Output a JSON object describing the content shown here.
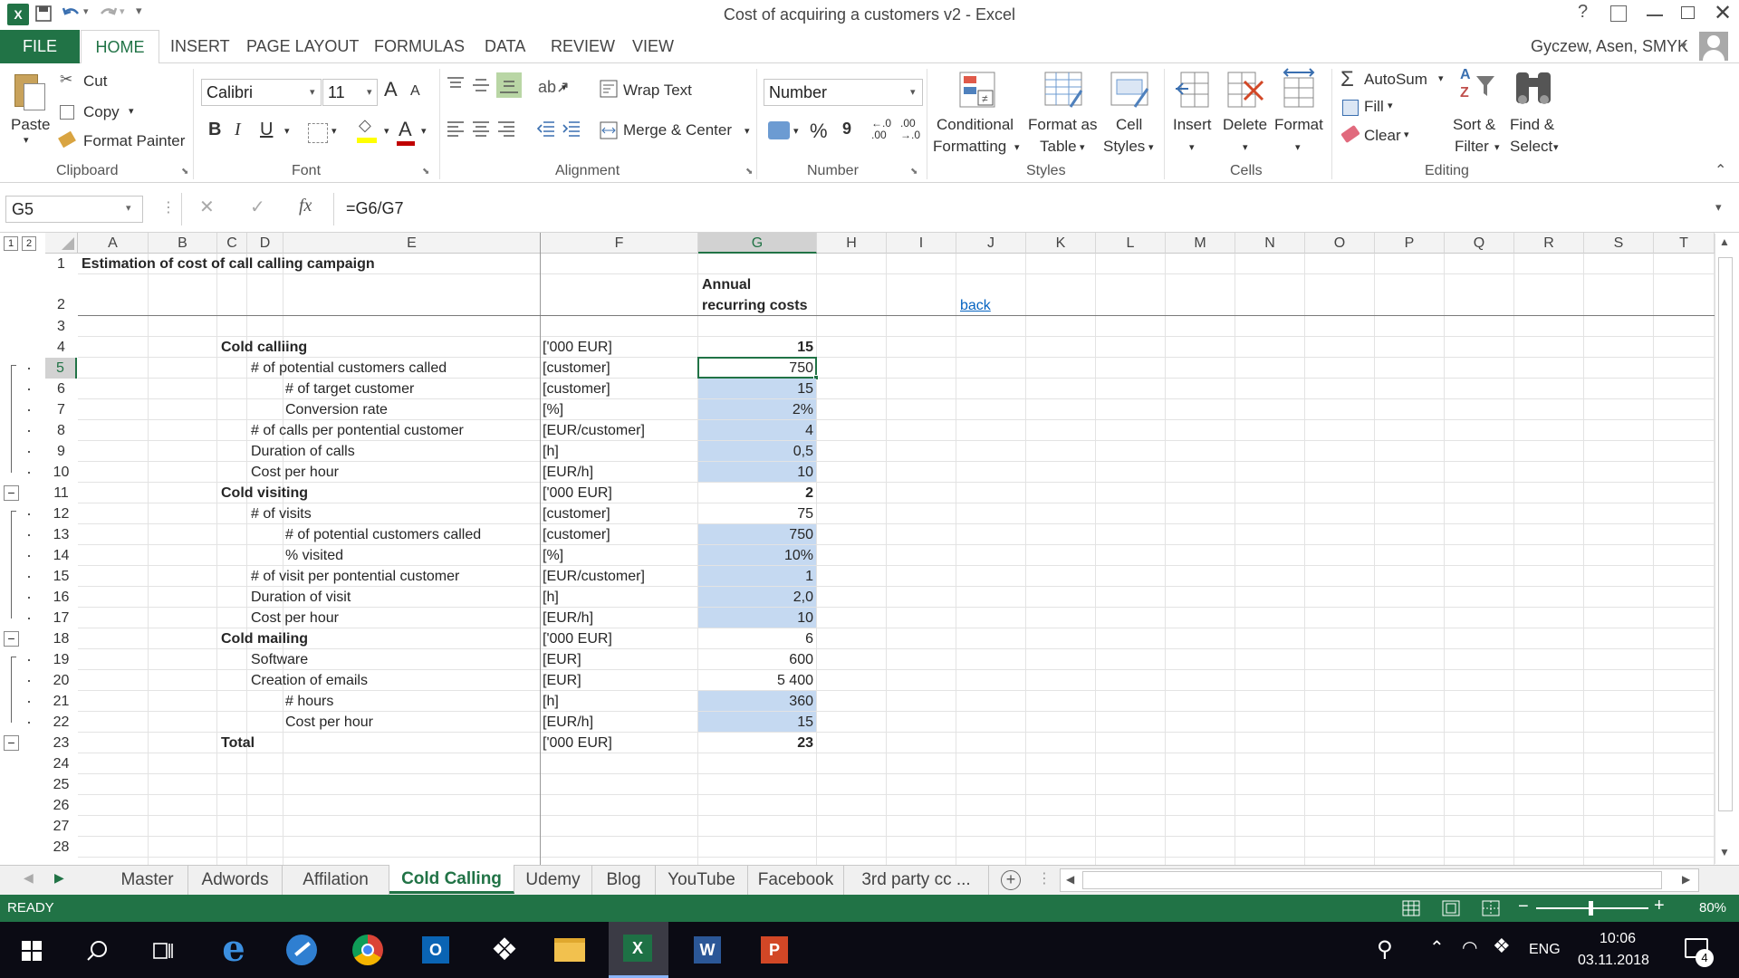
{
  "window": {
    "title": "Cost of acquiring a customers v2 - Excel",
    "user": "Gyczew, Asen, SMYK"
  },
  "ribbon_tabs": [
    "FILE",
    "HOME",
    "INSERT",
    "PAGE LAYOUT",
    "FORMULAS",
    "DATA",
    "REVIEW",
    "VIEW"
  ],
  "clipboard": {
    "paste": "Paste",
    "cut": "Cut",
    "copy": "Copy",
    "format_painter": "Format Painter",
    "label": "Clipboard"
  },
  "font": {
    "name": "Calibri",
    "size": "11",
    "bold": "B",
    "italic": "I",
    "underline": "U",
    "label": "Font"
  },
  "alignment": {
    "wrap": "Wrap Text",
    "merge": "Merge & Center",
    "label": "Alignment"
  },
  "number": {
    "format": "Number",
    "percent": "%",
    "comma": "9",
    "inc": "←.0\n.00",
    "dec": ".00\n→.0",
    "label": "Number"
  },
  "styles": {
    "conditional": "Conditional",
    "formatting": "Formatting",
    "format_as": "Format as",
    "table": "Table",
    "cell": "Cell",
    "styles": "Styles",
    "label": "Styles"
  },
  "cells": {
    "insert": "Insert",
    "delete": "Delete",
    "format": "Format",
    "label": "Cells"
  },
  "editing": {
    "autosum": "AutoSum",
    "fill": "Fill",
    "clear": "Clear",
    "sort": "Sort &",
    "filter": "Filter",
    "find": "Find &",
    "select": "Select",
    "label": "Editing"
  },
  "formula_bar": {
    "name_box": "G5",
    "fx": "fx",
    "formula": "=G6/G7"
  },
  "outline_levels": [
    "1",
    "2"
  ],
  "columns": [
    "A",
    "B",
    "C",
    "D",
    "E",
    "F",
    "G",
    "H",
    "I",
    "J",
    "K",
    "L",
    "M",
    "N",
    "O",
    "P",
    "Q",
    "R",
    "S",
    "T"
  ],
  "rows": [
    "1",
    "2",
    "3",
    "4",
    "5",
    "6",
    "7",
    "8",
    "9",
    "10",
    "11",
    "12",
    "13",
    "14",
    "15",
    "16",
    "17",
    "18",
    "19",
    "20",
    "21",
    "22",
    "23",
    "24",
    "25",
    "26",
    "27",
    "28"
  ],
  "sheet": {
    "title": "Estimation of cost of call calling campaign",
    "header_line1": "Annual",
    "header_line2": "recurring costs",
    "back": "back",
    "lines": [
      {
        "row": "4",
        "label": "Cold calliing",
        "indent": 0,
        "bold": true,
        "unit": "['000 EUR]",
        "value": "15",
        "vbold": true,
        "shade": false
      },
      {
        "row": "5",
        "label": "# of potential customers called",
        "indent": 1,
        "unit": "[customer]",
        "value": "750",
        "shade": false,
        "selected": true
      },
      {
        "row": "6",
        "label": "# of target customer",
        "indent": 2,
        "unit": "[customer]",
        "value": "15",
        "shade": true
      },
      {
        "row": "7",
        "label": "Conversion rate",
        "indent": 2,
        "unit": "[%]",
        "value": "2%",
        "shade": true
      },
      {
        "row": "8",
        "label": "# of calls per pontential customer",
        "indent": 1,
        "unit": "[EUR/customer]",
        "value": "4",
        "shade": true
      },
      {
        "row": "9",
        "label": "Duration of calls",
        "indent": 1,
        "unit": "[h]",
        "value": "0,5",
        "shade": true
      },
      {
        "row": "10",
        "label": "Cost per hour",
        "indent": 1,
        "unit": "[EUR/h]",
        "value": "10",
        "shade": true
      },
      {
        "row": "11",
        "label": "Cold visiting",
        "indent": 0,
        "bold": true,
        "unit": "['000 EUR]",
        "value": "2",
        "vbold": true,
        "shade": false
      },
      {
        "row": "12",
        "label": "# of visits",
        "indent": 1,
        "unit": "[customer]",
        "value": "75",
        "shade": false
      },
      {
        "row": "13",
        "label": "# of potential customers called",
        "indent": 2,
        "unit": "[customer]",
        "value": "750",
        "shade": true
      },
      {
        "row": "14",
        "label": "% visited",
        "indent": 2,
        "unit": "[%]",
        "value": "10%",
        "shade": true
      },
      {
        "row": "15",
        "label": "# of visit per pontential customer",
        "indent": 1,
        "unit": "[EUR/customer]",
        "value": "1",
        "shade": true
      },
      {
        "row": "16",
        "label": "Duration of visit",
        "indent": 1,
        "unit": "[h]",
        "value": "2,0",
        "shade": true
      },
      {
        "row": "17",
        "label": "Cost per hour",
        "indent": 1,
        "unit": "[EUR/h]",
        "value": "10",
        "shade": true
      },
      {
        "row": "18",
        "label": "Cold mailing",
        "indent": 0,
        "bold": true,
        "unit": "['000 EUR]",
        "value": "6",
        "shade": false
      },
      {
        "row": "19",
        "label": "Software",
        "indent": 1,
        "unit": "[EUR]",
        "value": "600",
        "shade": false
      },
      {
        "row": "20",
        "label": "Creation of emails",
        "indent": 1,
        "unit": "[EUR]",
        "value": "5 400",
        "shade": false
      },
      {
        "row": "21",
        "label": "# hours",
        "indent": 2,
        "unit": "[h]",
        "value": "360",
        "shade": true
      },
      {
        "row": "22",
        "label": "Cost per hour",
        "indent": 2,
        "unit": "[EUR/h]",
        "value": "15",
        "shade": true
      },
      {
        "row": "23",
        "label": "Total",
        "indent": 0,
        "bold": true,
        "unit": "['000 EUR]",
        "value": "23",
        "vbold": true,
        "shade": false
      }
    ]
  },
  "sheet_tabs": [
    "Master",
    "Adwords",
    "Affilation",
    "Cold Calling",
    "Udemy",
    "Blog",
    "YouTube",
    "Facebook",
    "3rd party cc ..."
  ],
  "active_sheet": "Cold Calling",
  "status": {
    "ready": "READY",
    "zoom": "80%"
  },
  "taskbar": {
    "lang": "ENG",
    "time": "10:06",
    "date": "03.11.2018",
    "notifications": "4"
  },
  "colors": {
    "excel_green": "#217346",
    "shade": "#c5d9f1",
    "selected_border": "#217346"
  }
}
